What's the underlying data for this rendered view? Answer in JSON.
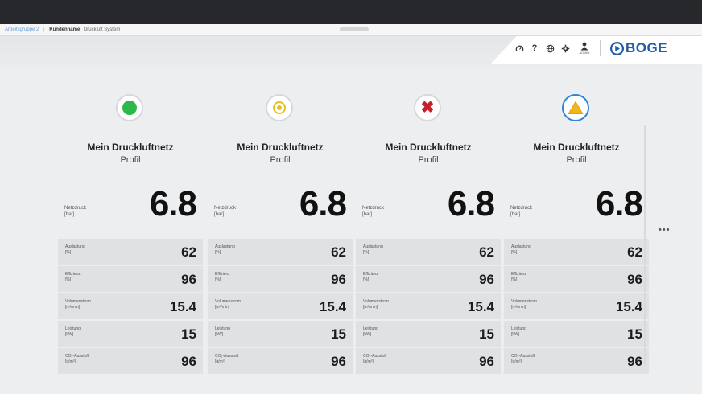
{
  "topbar": {},
  "tabbar": {
    "breadcrumb_link": "Arbeitsgruppe 2",
    "title": "Kundenname",
    "subtitle": "Druckluft System"
  },
  "header": {
    "icons": [
      "dashboard-icon",
      "help-icon",
      "globe-icon",
      "settings-icon",
      "user-icon"
    ],
    "help_glyph": "?",
    "user_label": "ADMIN",
    "logo_text": "BOGE"
  },
  "cards": [
    {
      "status": "ok",
      "title": "Mein Druckluftnetz",
      "subtitle": "Profil",
      "main_label": "Netzdruck",
      "main_unit": "[bar]",
      "main_value": "6.8",
      "metrics": [
        {
          "label": "Auslastung",
          "unit": "[%]",
          "value": "62"
        },
        {
          "label": "Effizienz",
          "unit": "[%]",
          "value": "96"
        },
        {
          "label": "Volumenstrom",
          "unit": "[m³/min]",
          "value": "15.4"
        },
        {
          "label": "Leistung",
          "unit": "[kW]",
          "value": "15"
        },
        {
          "label": "CO₂-Ausstoß",
          "unit": "[g/m³]",
          "value": "96"
        }
      ]
    },
    {
      "status": "warning",
      "title": "Mein Druckluftnetz",
      "subtitle": "Profil",
      "main_label": "Netzdruck",
      "main_unit": "[bar]",
      "main_value": "6.8",
      "metrics": [
        {
          "label": "Auslastung",
          "unit": "[%]",
          "value": "62"
        },
        {
          "label": "Effizienz",
          "unit": "[%]",
          "value": "96"
        },
        {
          "label": "Volumenstrom",
          "unit": "[m³/min]",
          "value": "15.4"
        },
        {
          "label": "Leistung",
          "unit": "[kW]",
          "value": "15"
        },
        {
          "label": "CO₂-Ausstoß",
          "unit": "[g/m³]",
          "value": "96"
        }
      ]
    },
    {
      "status": "error",
      "title": "Mein Druckluftnetz",
      "subtitle": "Profil",
      "main_label": "Netzdruck",
      "main_unit": "[bar]",
      "main_value": "6.8",
      "metrics": [
        {
          "label": "Auslastung",
          "unit": "[%]",
          "value": "62"
        },
        {
          "label": "Effizienz",
          "unit": "[%]",
          "value": "96"
        },
        {
          "label": "Volumenstrom",
          "unit": "[m³/min]",
          "value": "15.4"
        },
        {
          "label": "Leistung",
          "unit": "[kW]",
          "value": "15"
        },
        {
          "label": "CO₂-Ausstoß",
          "unit": "[g/m³]",
          "value": "96"
        }
      ]
    },
    {
      "status": "alert",
      "title": "Mein Druckluftnetz",
      "subtitle": "Profil",
      "main_label": "Netzdruck",
      "main_unit": "[bar]",
      "main_value": "6.8",
      "metrics": [
        {
          "label": "Auslastung",
          "unit": "[%]",
          "value": "62"
        },
        {
          "label": "Effizienz",
          "unit": "[%]",
          "value": "96"
        },
        {
          "label": "Volumenstrom",
          "unit": "[m³/min]",
          "value": "15.4"
        },
        {
          "label": "Leistung",
          "unit": "[kW]",
          "value": "15"
        },
        {
          "label": "CO₂-Ausstoß",
          "unit": "[g/m³]",
          "value": "96"
        }
      ]
    }
  ],
  "more_glyph": "•••",
  "colors": {
    "ok": "#2db84a",
    "warning": "#e4c21c",
    "error": "#c91d2a",
    "alert": "#f2b51d",
    "alert_ring": "#2a86d6",
    "brand": "#1f5ba8"
  }
}
